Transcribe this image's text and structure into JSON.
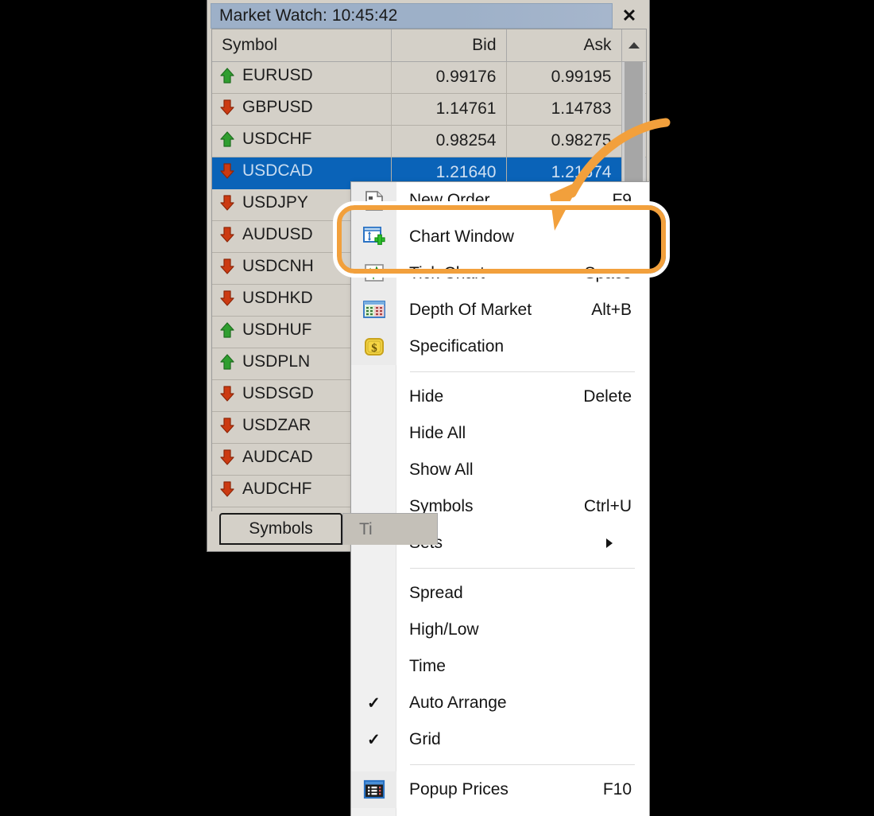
{
  "window": {
    "title": "Market Watch: 10:45:42",
    "close_label": "✕"
  },
  "table": {
    "columns": [
      "Symbol",
      "Bid",
      "Ask"
    ],
    "rows": [
      {
        "symbol": "EURUSD",
        "dir": "up",
        "bid": "0.99176",
        "ask": "0.99195",
        "selected": false
      },
      {
        "symbol": "GBPUSD",
        "dir": "down",
        "bid": "1.14761",
        "ask": "1.14783",
        "selected": false
      },
      {
        "symbol": "USDCHF",
        "dir": "up",
        "bid": "0.98254",
        "ask": "0.98275",
        "selected": false
      },
      {
        "symbol": "USDCAD",
        "dir": "down",
        "bid": "1.21640",
        "ask": "1.21674",
        "selected": true
      },
      {
        "symbol": "USDJPY",
        "dir": "down",
        "bid": "",
        "ask": "",
        "selected": false
      },
      {
        "symbol": "AUDUSD",
        "dir": "down",
        "bid": "",
        "ask": "",
        "selected": false
      },
      {
        "symbol": "USDCNH",
        "dir": "down",
        "bid": "",
        "ask": "",
        "selected": false
      },
      {
        "symbol": "USDHKD",
        "dir": "down",
        "bid": "",
        "ask": "",
        "selected": false
      },
      {
        "symbol": "USDHUF",
        "dir": "up",
        "bid": "",
        "ask": "",
        "selected": false
      },
      {
        "symbol": "USDPLN",
        "dir": "up",
        "bid": "",
        "ask": "",
        "selected": false
      },
      {
        "symbol": "USDSGD",
        "dir": "down",
        "bid": "",
        "ask": "",
        "selected": false
      },
      {
        "symbol": "USDZAR",
        "dir": "down",
        "bid": "",
        "ask": "",
        "selected": false
      },
      {
        "symbol": "AUDCAD",
        "dir": "down",
        "bid": "",
        "ask": "",
        "selected": false
      },
      {
        "symbol": "AUDCHF",
        "dir": "down",
        "bid": "",
        "ask": "",
        "selected": false
      }
    ]
  },
  "tabs": {
    "active": "Symbols",
    "inactive": "Ti"
  },
  "context_menu": {
    "items": [
      {
        "label": "New Order",
        "accel": "F9",
        "icon": "new-order-icon",
        "checked": false,
        "submenu": false
      },
      {
        "label": "Chart Window",
        "accel": "",
        "icon": "chart-window-icon",
        "checked": false,
        "submenu": false
      },
      {
        "label": "Tick Chart",
        "accel": "Space",
        "icon": "tick-chart-icon",
        "checked": false,
        "submenu": false
      },
      {
        "label": "Depth Of Market",
        "accel": "Alt+B",
        "icon": "depth-market-icon",
        "checked": false,
        "submenu": false
      },
      {
        "label": "Specification",
        "accel": "",
        "icon": "specification-icon",
        "checked": false,
        "submenu": false
      },
      {
        "label": "Hide",
        "accel": "Delete",
        "icon": "",
        "checked": false,
        "submenu": false
      },
      {
        "label": "Hide All",
        "accel": "",
        "icon": "",
        "checked": false,
        "submenu": false
      },
      {
        "label": "Show All",
        "accel": "",
        "icon": "",
        "checked": false,
        "submenu": false
      },
      {
        "label": "Symbols",
        "accel": "Ctrl+U",
        "icon": "",
        "checked": false,
        "submenu": false
      },
      {
        "label": "Sets",
        "accel": "",
        "icon": "",
        "checked": false,
        "submenu": true
      },
      {
        "label": "Spread",
        "accel": "",
        "icon": "",
        "checked": false,
        "submenu": false
      },
      {
        "label": "High/Low",
        "accel": "",
        "icon": "",
        "checked": false,
        "submenu": false
      },
      {
        "label": "Time",
        "accel": "",
        "icon": "",
        "checked": false,
        "submenu": false
      },
      {
        "label": "Auto Arrange",
        "accel": "",
        "icon": "",
        "checked": true,
        "submenu": false
      },
      {
        "label": "Grid",
        "accel": "",
        "icon": "",
        "checked": true,
        "submenu": false
      },
      {
        "label": "Popup Prices",
        "accel": "F10",
        "icon": "popup-prices-icon",
        "checked": false,
        "submenu": false
      }
    ],
    "separators_after": [
      4,
      9,
      14
    ],
    "highlighted_label": "Chart Window"
  },
  "colors": {
    "accent_orange": "#f2a03c",
    "selection_blue": "#0a63b8",
    "price_up": "#1515c8",
    "price_down": "#d01010",
    "panel_gray": "#d4d0c8",
    "titlebar_blue": "#9db0c8"
  }
}
